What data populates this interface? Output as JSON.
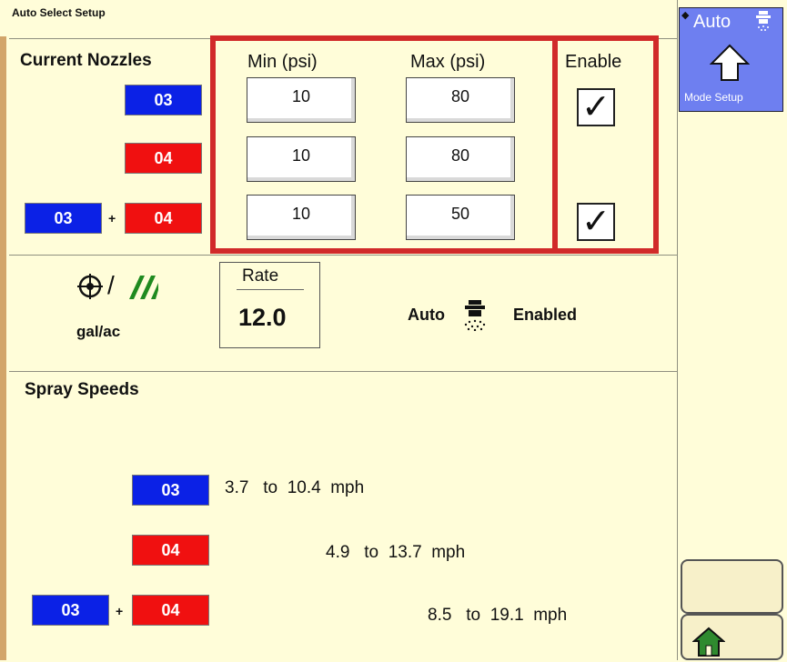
{
  "window": {
    "title": "Auto Select Setup"
  },
  "nozzles": {
    "header": "Current Nozzles",
    "rows": [
      {
        "chips": [
          {
            "label": "03",
            "color": "blue"
          }
        ]
      },
      {
        "chips": [
          {
            "label": "04",
            "color": "red"
          }
        ]
      },
      {
        "chips": [
          {
            "label": "03",
            "color": "blue"
          },
          {
            "label": "04",
            "color": "red"
          }
        ],
        "joiner": "+"
      }
    ]
  },
  "pressure": {
    "min_header": "Min (psi)",
    "max_header": "Max (psi)",
    "enable_header": "Enable",
    "rows": [
      {
        "min": "10",
        "max": "80",
        "enabled": true
      },
      {
        "min": "10",
        "max": "80",
        "enabled": false
      },
      {
        "min": "10",
        "max": "50",
        "enabled": true
      }
    ],
    "checkmark": "✓"
  },
  "rate": {
    "units": "gal/ac",
    "label": "Rate",
    "value": "12.0"
  },
  "auto_status": {
    "prefix": "Auto",
    "status": "Enabled"
  },
  "spray_speeds": {
    "header": "Spray Speeds",
    "rows": [
      {
        "chips": [
          {
            "label": "03",
            "color": "blue"
          }
        ],
        "min": "3.7",
        "to": "to",
        "max": "10.4",
        "unit": "mph"
      },
      {
        "chips": [
          {
            "label": "04",
            "color": "red"
          }
        ],
        "min": "4.9",
        "to": "to",
        "max": "13.7",
        "unit": "mph"
      },
      {
        "chips": [
          {
            "label": "03",
            "color": "blue"
          },
          {
            "label": "04",
            "color": "red"
          }
        ],
        "joiner": "+",
        "min": "8.5",
        "to": "to",
        "max": "19.1",
        "unit": "mph"
      }
    ]
  },
  "side": {
    "mode_button_top": "Auto",
    "mode_button_bottom": "Mode Setup"
  },
  "colors": {
    "background": "#fffdd9",
    "blue_chip": "#0b21e6",
    "red_chip": "#f01010",
    "highlight_box": "#d12a2a",
    "mode_button": "#6e7ff0",
    "home_icon": "#2f8a2f"
  },
  "icons": {
    "target": "target-icon",
    "field": "field-stripes-icon",
    "spray": "sprayer-icon",
    "up_arrow": "up-arrow-icon",
    "home": "home-icon"
  }
}
